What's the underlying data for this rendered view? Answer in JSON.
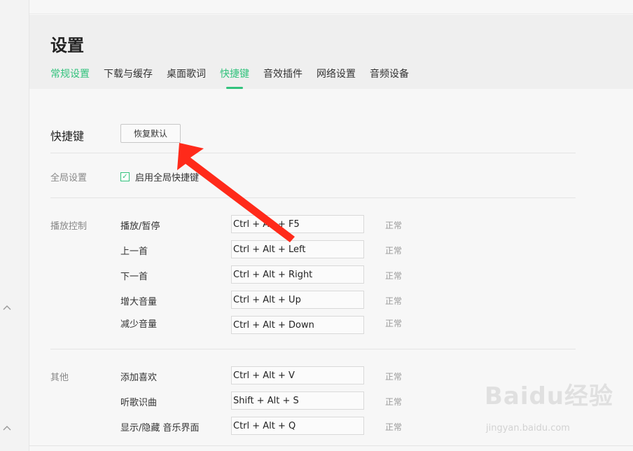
{
  "header": {
    "title": "设置"
  },
  "tabs": [
    {
      "label": "常规设置"
    },
    {
      "label": "下载与缓存"
    },
    {
      "label": "桌面歌词"
    },
    {
      "label": "快捷键"
    },
    {
      "label": "音效插件"
    },
    {
      "label": "网络设置"
    },
    {
      "label": "音频设备"
    }
  ],
  "shortcuts": {
    "section_title": "快捷键",
    "reset_label": "恢复默认",
    "global_label": "全局设置",
    "global_checkbox_label": "启用全局快捷键",
    "global_checked": true,
    "playback_group_label": "播放控制",
    "playback": [
      {
        "action": "播放/暂停",
        "keys": "Ctrl + Alt + F5",
        "status": "正常"
      },
      {
        "action": "上一首",
        "keys": "Ctrl + Alt + Left",
        "status": "正常"
      },
      {
        "action": "下一首",
        "keys": "Ctrl + Alt + Right",
        "status": "正常"
      },
      {
        "action": "增大音量",
        "keys": "Ctrl + Alt + Up",
        "status": "正常"
      },
      {
        "action": "减少音量",
        "keys": "Ctrl + Alt + Down",
        "status": "正常"
      }
    ],
    "other_group_label": "其他",
    "other": [
      {
        "action": "添加喜欢",
        "keys": "Ctrl + Alt + V",
        "status": "正常"
      },
      {
        "action": "听歌识曲",
        "keys": "Shift + Alt + S",
        "status": "正常"
      },
      {
        "action": "显示/隐藏 音乐界面",
        "keys": "Ctrl + Alt + Q",
        "status": "正常"
      }
    ]
  },
  "watermark": {
    "brand": "Baidu经验",
    "url": "jingyan.baidu.com"
  },
  "colors": {
    "accent": "#31c27c",
    "arrow": "#ff2a1a"
  },
  "icons": {
    "checkbox": "check-icon",
    "chevron": "chevron-up-icon",
    "annotation": "red-arrow"
  }
}
